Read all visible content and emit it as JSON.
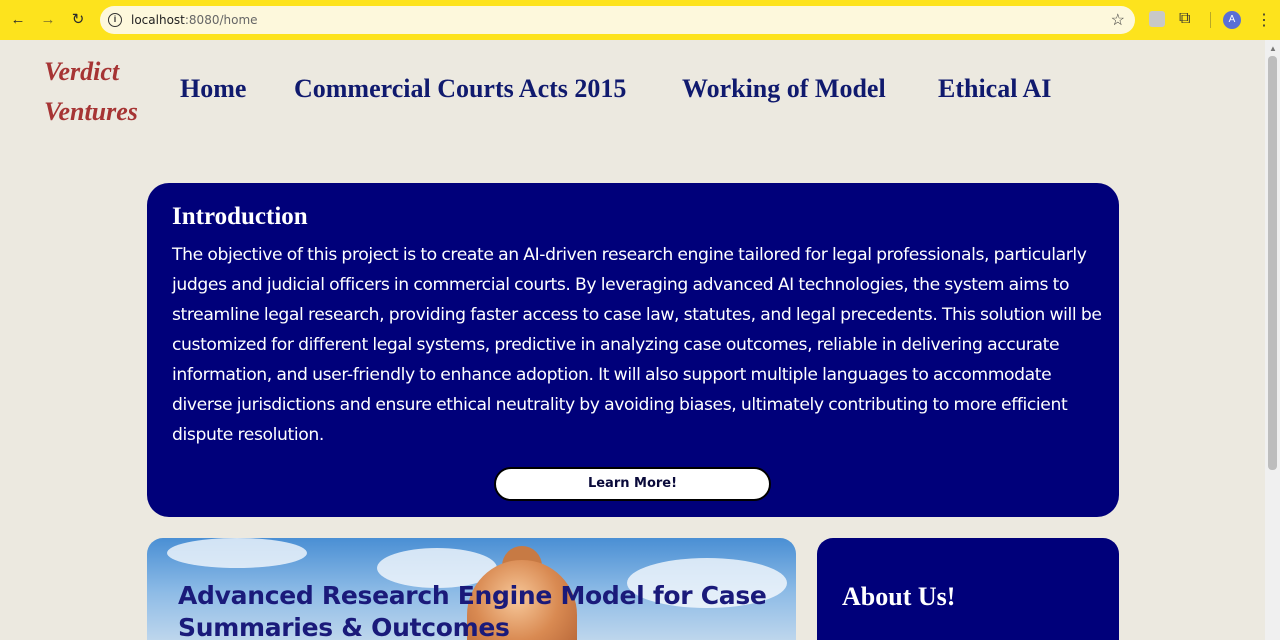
{
  "browser": {
    "url_host": "localhost",
    "url_path": ":8080/home",
    "icons": [
      "back-icon",
      "forward-icon",
      "reload-icon",
      "info-icon",
      "star-icon",
      "extension-icon",
      "puzzle-icon",
      "menu-icon"
    ],
    "avatar_letter": "A"
  },
  "site": {
    "logo_line1": "Verdict",
    "logo_line2": "Ventures",
    "nav": [
      "Home",
      "Commercial Courts Acts 2015",
      "Working of Model",
      "Ethical AI"
    ]
  },
  "intro": {
    "title": "Introduction",
    "body": "The objective of this project is to create an AI-driven research engine tailored for legal professionals, particularly judges and judicial officers in commercial courts. By leveraging advanced AI technologies, the system aims to streamline legal research, providing faster access to case law, statutes, and legal precedents. This solution will be customized for different legal systems, predictive in analyzing case outcomes, reliable in delivering accurate information, and user-friendly to enhance adoption. It will also support multiple languages to accommodate diverse jurisdictions and ensure ethical neutrality by avoiding biases, ultimately contributing to more efficient dispute resolution.",
    "button": "Learn More!"
  },
  "research": {
    "title": "Advanced Research Engine Model for Case Summaries & Outcomes"
  },
  "about": {
    "title": "About Us!"
  },
  "colors": {
    "chrome": "#fde31d",
    "page_bg": "#ece9e0",
    "card_navy": "#00007a",
    "logo_red": "#a63434",
    "nav_navy": "#101a6e"
  }
}
